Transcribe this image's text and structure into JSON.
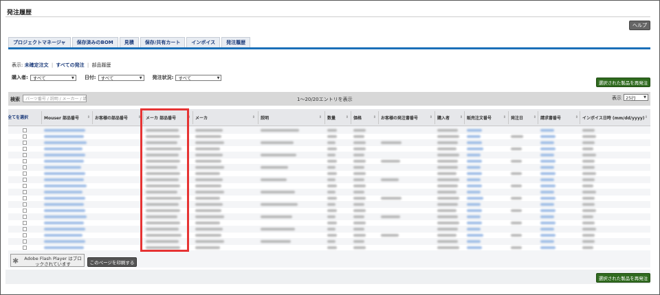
{
  "page_title": "発注履歴",
  "help_label": "ヘルプ",
  "tabs": [
    "プロジェクトマネージャ",
    "保存済みのBOM",
    "見積",
    "保存/共有カート",
    "インボイス",
    "発注履歴"
  ],
  "display_line": {
    "prefix": "表示:",
    "link1": "未確定注文",
    "sep1": "|",
    "link2": "すべての発注",
    "sep2": "|",
    "current": "部品履歴"
  },
  "filters": {
    "buyer_label": "購入者:",
    "buyer_value": "すべて",
    "date_label": "日付:",
    "date_value": "すべて",
    "status_label": "発注状況:",
    "status_value": "すべて"
  },
  "reorder_label": "選択された製品を再発注",
  "toolbar": {
    "search_label": "検索",
    "search_placeholder": "パーツ番号 / 説明 / メーカー / 請",
    "entries_text": "1〜20/20エントリを表示",
    "show_label": "表示",
    "show_value": "25行"
  },
  "table": {
    "select_all": "全てを選択",
    "columns": [
      "Mouser 部品番号",
      "お客様の部品番号",
      "メーカ 部品番号",
      "メーカ",
      "説明",
      "数量",
      "価格",
      "お客様の発注書番号",
      "購入者",
      "販売注文番号",
      "発注日",
      "請求書番号",
      "インボイス日時 (mm/dd/yyyy)"
    ],
    "row_count": 20
  },
  "flash_notice": "Adobe Flash Player はブロックされています",
  "print_label": "このページを印刷する",
  "icons": {
    "sort": "sort-arrows-icon",
    "dropdown": "chevron-down-icon",
    "plugin": "puzzle-piece-icon"
  },
  "colors": {
    "tab_rule": "#1a6fb8",
    "reorder_button": "#2f6a1e",
    "highlight": "#e63333",
    "link": "#1a3a7a",
    "blur_link": "#9fbde6",
    "blur_text": "#b8b8b8"
  }
}
